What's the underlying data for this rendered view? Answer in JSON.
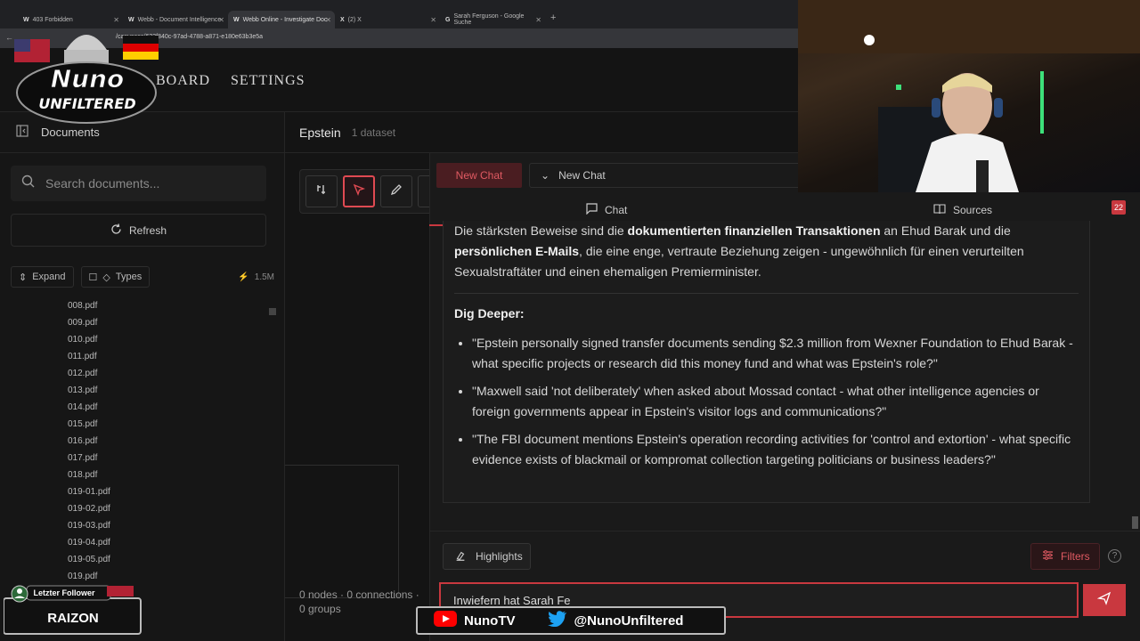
{
  "browser": {
    "tabs": [
      {
        "icon": "W",
        "label": "403 Forbidden"
      },
      {
        "icon": "W",
        "label": "Webb - Document Intelligence"
      },
      {
        "icon": "W",
        "label": "Webb Online - Investigate Doc"
      },
      {
        "icon": "X",
        "label": "(2) X"
      },
      {
        "icon": "G",
        "label": "Sarah Ferguson - Google Suche"
      }
    ],
    "url": "/canvases/633f840c-97ad-4788-a871-e180e63b3e5a"
  },
  "header": {
    "nav": [
      "BOARD",
      "SETTINGS"
    ]
  },
  "sidebar": {
    "title": "Documents",
    "search_placeholder": "Search documents...",
    "refresh_label": "Refresh",
    "expand_label": "Expand",
    "types_label": "Types",
    "size": "1.5M",
    "files": [
      "008.pdf",
      "009.pdf",
      "010.pdf",
      "011.pdf",
      "012.pdf",
      "013.pdf",
      "014.pdf",
      "015.pdf",
      "016.pdf",
      "017.pdf",
      "018.pdf",
      "019-01.pdf",
      "019-02.pdf",
      "019-03.pdf",
      "019-04.pdf",
      "019-05.pdf",
      "019.pdf"
    ]
  },
  "canvas": {
    "title": "Epstein",
    "subtitle": "1 dataset",
    "status": "0 nodes · 0 connections · 0 groups"
  },
  "chat": {
    "new_chat_button": "New Chat",
    "selected_chat": "New Chat",
    "tab_chat": "Chat",
    "tab_sources": "Sources",
    "sources_count": "22",
    "answer": {
      "p1_a": "Die stärksten Beweise sind die ",
      "p1_b": "dokumentierten finanziellen Transaktionen",
      "p1_c": " an Ehud Barak und die ",
      "p1_d": "persönlichen E-Mails",
      "p1_e": ", die eine enge, vertraute Beziehung zeigen - ungewöhnlich für einen verurteilten Sexualstraftäter und einen ehemaligen Premierminister.",
      "heading": "Dig Deeper:",
      "bullets": [
        "\"Epstein personally signed transfer documents sending $2.3 million from Wexner Foundation to Ehud Barak - what specific projects or research did this money fund and what was Epstein's role?\"",
        "\"Maxwell said 'not deliberately' when asked about Mossad contact - what other intelligence agencies or foreign governments appear in Epstein's visitor logs and communications?\"",
        "\"The FBI document mentions Epstein's operation recording activities for 'control and extortion' - what specific evidence exists of blackmail or kompromat collection targeting politicians or business leaders?\""
      ]
    },
    "highlights_label": "Highlights",
    "filters_label": "Filters",
    "input_value": "Inwiefern hat Sarah Fe"
  },
  "overlay": {
    "logo_line1": "Nuno",
    "logo_line2": "UNFILTERED",
    "follower_label": "Letzter Follower",
    "follower_name": "RAIZON",
    "social_youtube": "NunoTV",
    "social_twitter": "@NunoUnfiltered"
  },
  "colors": {
    "accent": "#c9383f",
    "background": "#141414"
  }
}
